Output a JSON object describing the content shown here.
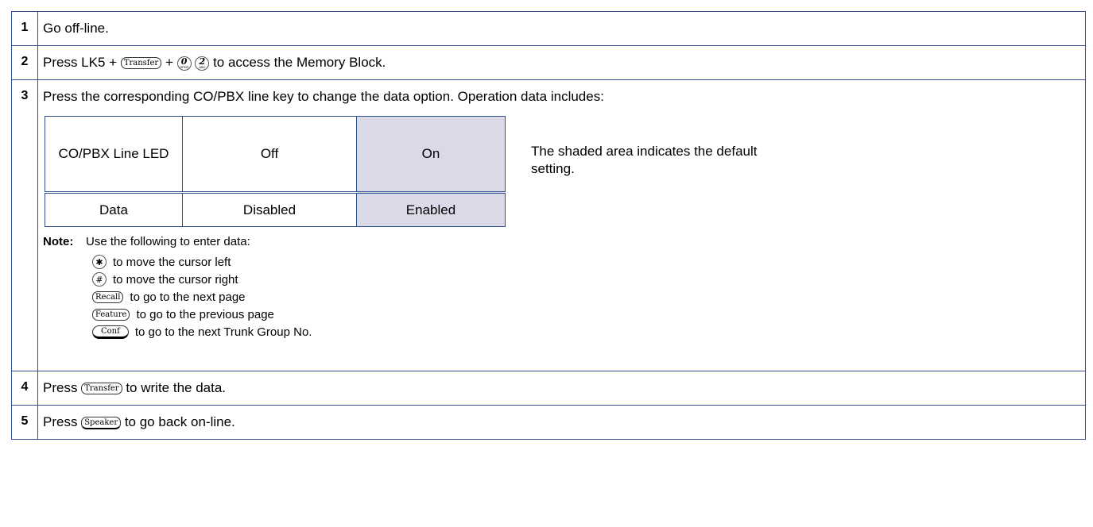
{
  "steps": [
    {
      "num": "1",
      "text": "Go off-line."
    },
    {
      "num": "2",
      "prefix": "Press LK5 +",
      "plus": "+",
      "suffix": "to access the Memory Block."
    },
    {
      "num": "3",
      "intro": "Press the corresponding CO/PBX line key to change the data option. Operation data includes:"
    },
    {
      "num": "4",
      "prefix": "Press",
      "suffix": "to write the data."
    },
    {
      "num": "5",
      "prefix": "Press",
      "suffix": "to go back on-line."
    }
  ],
  "keys": {
    "transfer": "Transfer",
    "zero_big": "0",
    "zero_small": "OPER",
    "two_big": "2",
    "two_small": "ABC",
    "star": "✱",
    "hash": "#",
    "recall": "Recall",
    "feature": "Feature",
    "conf": "Conf",
    "speaker": "Speaker"
  },
  "option_table": {
    "header": [
      "CO/PBX Line LED",
      "Off",
      "On"
    ],
    "row": [
      "Data",
      "Disabled",
      "Enabled"
    ],
    "default_col": 2
  },
  "default_note": "The shaded area indicates the default setting.",
  "note": {
    "label": "Note:",
    "text": "Use the following to enter data:",
    "items": [
      "to move the cursor left",
      "to move the cursor right",
      "to go to the next page",
      "to go to the previous page",
      "to go to the next Trunk Group No."
    ]
  }
}
